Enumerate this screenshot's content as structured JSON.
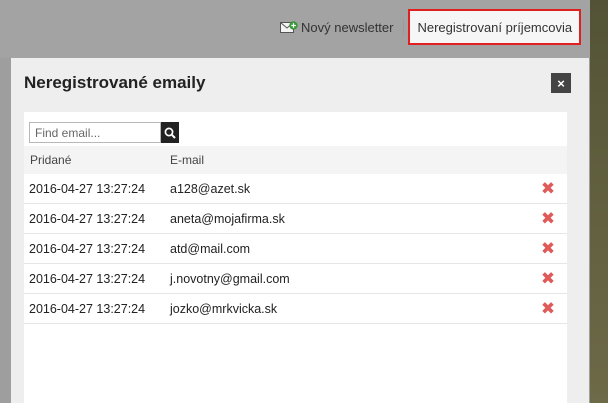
{
  "topbar": {
    "newsletter_label": "Nový newsletter",
    "unregistered_label": "Neregistrovaní príjemcovia"
  },
  "modal": {
    "title": "Neregistrované emaily",
    "close_label": "×",
    "search": {
      "placeholder": "Find email..."
    },
    "columns": {
      "added": "Pridané",
      "email": "E-mail"
    },
    "rows": [
      {
        "added": "2016-04-27 13:27:24",
        "email": "a128@azet.sk"
      },
      {
        "added": "2016-04-27 13:27:24",
        "email": "aneta@mojafirma.sk"
      },
      {
        "added": "2016-04-27 13:27:24",
        "email": "atd@mail.com"
      },
      {
        "added": "2016-04-27 13:27:24",
        "email": "j.novotny@gmail.com"
      },
      {
        "added": "2016-04-27 13:27:24",
        "email": "jozko@mrkvicka.sk"
      }
    ]
  },
  "colors": {
    "delete_icon": "#e05a5a",
    "highlight_border": "#e02020",
    "newsletter_icon": "#3a9a3a"
  },
  "icons": {
    "newsletter": "envelope-plus-icon",
    "search": "magnifier-icon",
    "delete": "cross-icon",
    "close": "close-icon"
  }
}
